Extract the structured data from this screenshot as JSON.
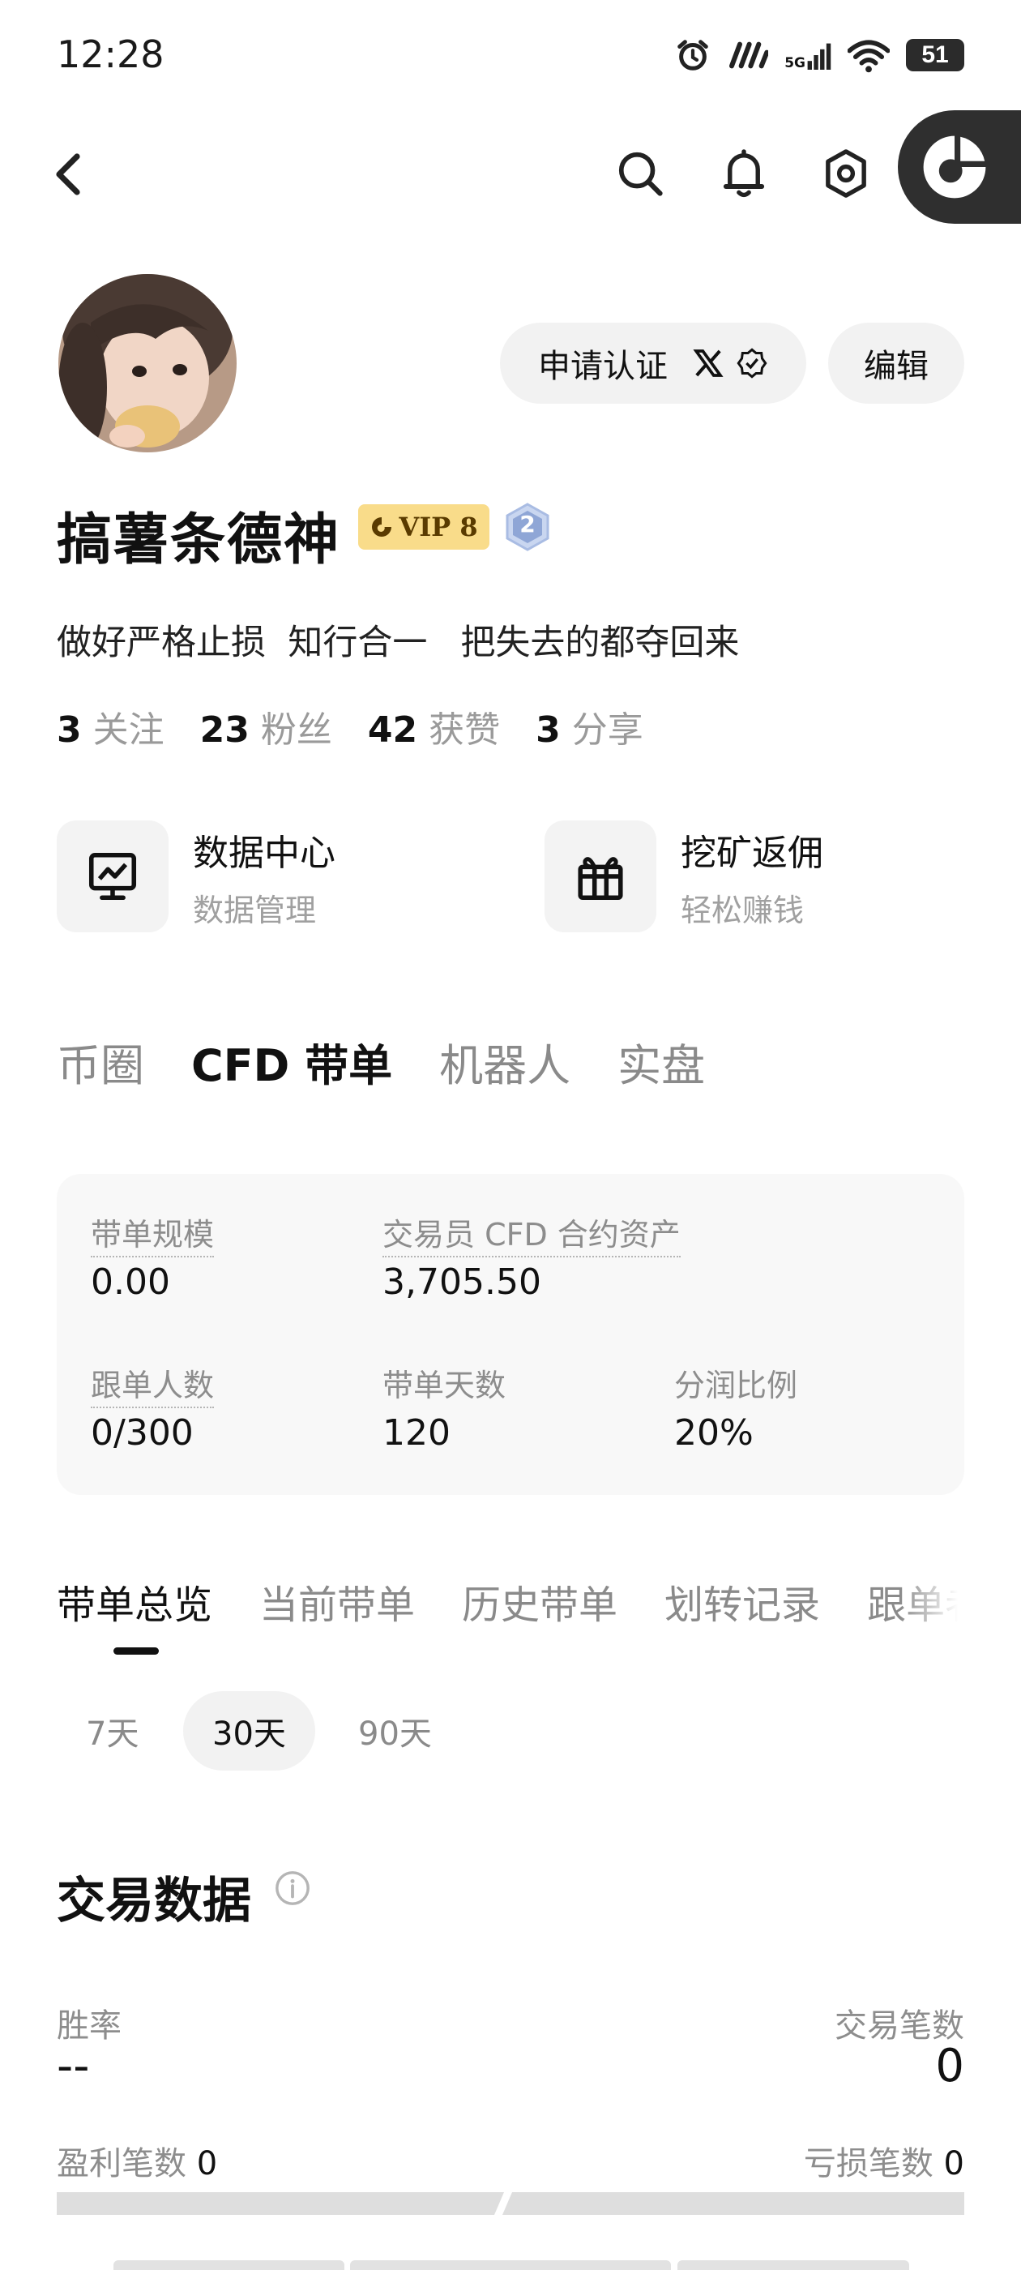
{
  "status_bar": {
    "time": "12:28",
    "network": "5G",
    "battery": "51"
  },
  "header": {
    "icons": [
      "back-chevron-icon",
      "search-icon",
      "bell-icon",
      "hexagon-settings-icon",
      "app-logo-icon"
    ]
  },
  "profile": {
    "apply_verify_label": "申请认证",
    "edit_label": "编辑",
    "name": "搞薯条德神",
    "vip_label": "VIP 8",
    "level_badge": "2",
    "bio": "做好严格止损  知行合一   把失去的都夺回来",
    "stats": [
      {
        "value": "3",
        "label": "关注"
      },
      {
        "value": "23",
        "label": "粉丝"
      },
      {
        "value": "42",
        "label": "获赞"
      },
      {
        "value": "3",
        "label": "分享"
      }
    ]
  },
  "shortcuts": [
    {
      "title": "数据中心",
      "subtitle": "数据管理",
      "icon": "chart-monitor-icon"
    },
    {
      "title": "挖矿返佣",
      "subtitle": "轻松赚钱",
      "icon": "gift-icon"
    }
  ],
  "main_tabs": [
    {
      "label": "币圈",
      "active": false
    },
    {
      "label": "CFD 带单",
      "active": true
    },
    {
      "label": "机器人",
      "active": false
    },
    {
      "label": "实盘",
      "active": false
    }
  ],
  "summary_card": {
    "scale_label": "带单规模",
    "scale_value": "0.00",
    "assets_label": "交易员 CFD 合约资产",
    "assets_value": "3,705.50",
    "followers_label": "跟单人数",
    "followers_value": "0/300",
    "days_label": "带单天数",
    "days_value": "120",
    "share_label": "分润比例",
    "share_value": "20%"
  },
  "sub_tabs": [
    {
      "label": "带单总览",
      "active": true
    },
    {
      "label": "当前带单",
      "active": false
    },
    {
      "label": "历史带单",
      "active": false
    },
    {
      "label": "划转记录",
      "active": false
    },
    {
      "label": "跟单者",
      "active": false
    }
  ],
  "periods": [
    {
      "label": "7天",
      "active": false
    },
    {
      "label": "30天",
      "active": true
    },
    {
      "label": "90天",
      "active": false
    }
  ],
  "trade_data": {
    "title": "交易数据",
    "win_rate_label": "胜率",
    "win_rate_value": "--",
    "trade_count_label": "交易笔数",
    "trade_count_value": "0",
    "profit_count_label": "盈利笔数",
    "profit_count_value": "0",
    "loss_count_label": "亏损笔数",
    "loss_count_value": "0"
  },
  "colors": {
    "vip_badge": "#f9dc8a",
    "card_bg": "#f8f8f8",
    "muted_text": "#8d8d8d"
  }
}
